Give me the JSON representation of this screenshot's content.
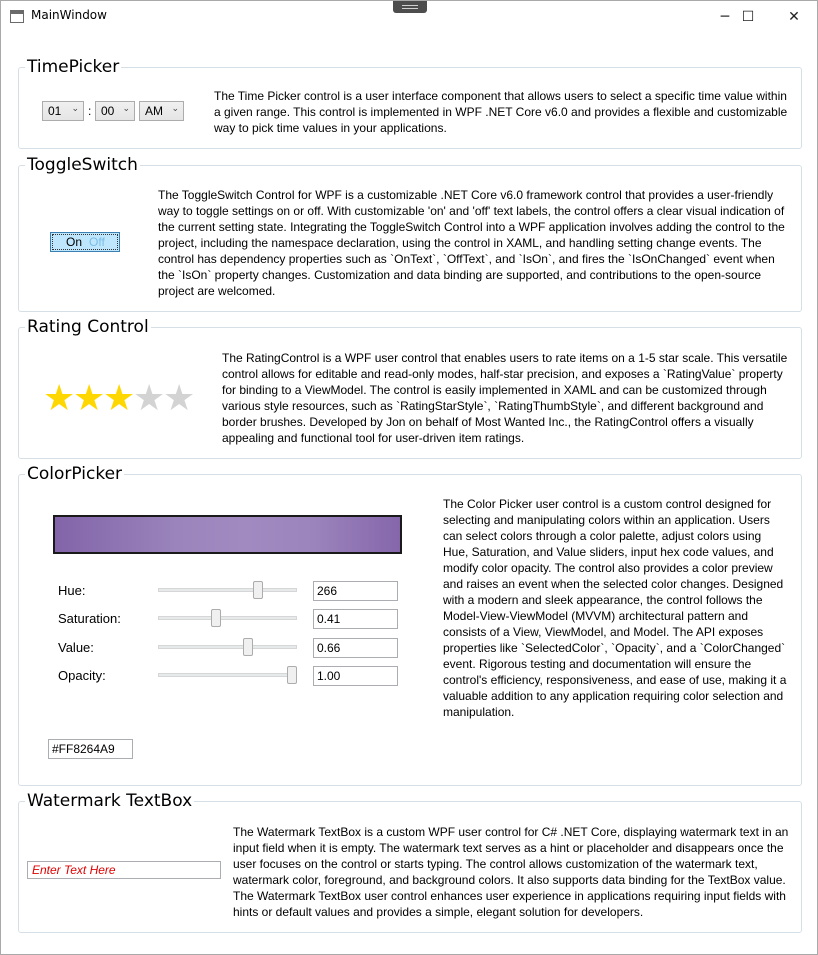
{
  "window": {
    "title": "MainWindow",
    "minimize_icon": "─",
    "maximize_icon": "☐",
    "close_icon": "✕"
  },
  "timepicker": {
    "legend": "TimePicker",
    "hour": "01",
    "separator": ":",
    "minute": "00",
    "ampm": "AM",
    "arrow": "⌄",
    "description": "The Time Picker control is a user interface component that allows users to select a specific time value within a given range. This control is implemented in WPF .NET Core v6.0 and provides a flexible and customizable way to pick time values in your applications."
  },
  "toggleswitch": {
    "legend": "ToggleSwitch",
    "on_text": "On",
    "off_text": "Off",
    "is_on": true,
    "description": "The ToggleSwitch Control for WPF is a customizable .NET Core v6.0 framework control that provides a user-friendly way to toggle settings on or off. With customizable 'on' and 'off' text labels, the control offers a clear visual indication of the current setting state. Integrating the ToggleSwitch Control into a WPF application involves adding the control to the project, including the namespace declaration, using the control in XAML, and handling setting change events. The control has dependency properties such as `OnText`, `OffText`, and `IsOn`, and fires the `IsOnChanged` event when the `IsOn` property changes. Customization and data binding are supported, and contributions to the open-source project are welcomed."
  },
  "rating": {
    "legend": "Rating Control",
    "value": 3,
    "max": 5,
    "star_glyph": "★",
    "filled_color": "#ffd700",
    "empty_color": "#d3d3d3",
    "description": "The RatingControl is a WPF user control that enables users to rate items on a 1-5 star scale. This versatile control allows for editable and read-only modes, half-star precision, and exposes a `RatingValue` property for binding to a ViewModel. The control is easily implemented in XAML and can be customized through various style resources, such as `RatingStarStyle`, `RatingThumbStyle`, and different background and border brushes. Developed by Jon on behalf of Most Wanted Inc., the RatingControl offers a visually appealing and functional tool for user-driven item ratings."
  },
  "colorpicker": {
    "legend": "ColorPicker",
    "preview_color": "#8264a9",
    "sliders": [
      {
        "label": "Hue:",
        "value": "266",
        "fraction": 0.74
      },
      {
        "label": "Saturation:",
        "value": "0.41",
        "fraction": 0.41
      },
      {
        "label": "Value:",
        "value": "0.66",
        "fraction": 0.66
      },
      {
        "label": "Opacity:",
        "value": "1.00",
        "fraction": 1.0
      }
    ],
    "hex": "#FF8264A9",
    "description": "The Color Picker user control is a custom control designed for selecting and manipulating colors within an application. Users can select colors through a color palette, adjust colors using Hue, Saturation, and Value sliders, input hex code values, and modify color opacity. The control also provides a color preview and raises an event when the selected color changes. Designed with a modern and sleek appearance, the control follows the Model-View-ViewModel (MVVM) architectural pattern and consists of a View, ViewModel, and Model. The API exposes properties like `SelectedColor`, `Opacity`, and a `ColorChanged` event. Rigorous testing and documentation will ensure the control's efficiency, responsiveness, and ease of use, making it a valuable addition to any application requiring color selection and manipulation."
  },
  "watermark": {
    "legend": "Watermark TextBox",
    "placeholder": "Enter Text Here",
    "watermark_color": "#e00000",
    "description": "The Watermark TextBox is a custom WPF user control for C# .NET Core, displaying watermark text in an input field when it is empty. The watermark text serves as a hint or placeholder and disappears once the user focuses on the control or starts typing. The control allows customization of the watermark text, watermark color, foreground, and background colors. It also supports data binding for the TextBox value. The Watermark TextBox user control enhances user experience in applications requiring input fields with hints or default values and provides a simple, elegant solution for developers."
  }
}
